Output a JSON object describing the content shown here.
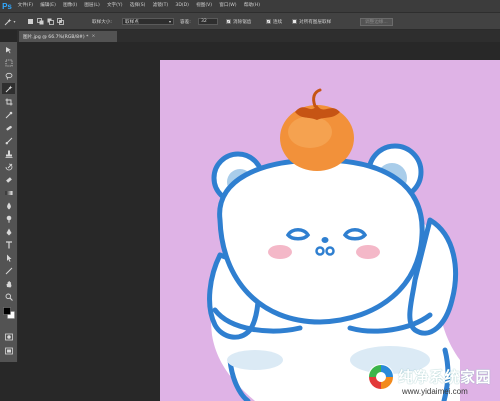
{
  "app": {
    "logo": "Ps"
  },
  "menu": [
    "文件(F)",
    "编辑(E)",
    "图像(I)",
    "图层(L)",
    "文字(Y)",
    "选择(S)",
    "滤镜(T)",
    "3D(D)",
    "视图(V)",
    "窗口(W)",
    "帮助(H)"
  ],
  "options": {
    "sample_size_label": "取样大小:",
    "sample_size_value": "取样点",
    "tolerance_label": "容差:",
    "tolerance_value": "32",
    "antialias_label": "消除锯齿",
    "antialias_checked": true,
    "contiguous_label": "连续",
    "contiguous_checked": true,
    "all_layers_label": "对所有图层取样",
    "all_layers_checked": false,
    "refine_edge_label": "调整边缘..."
  },
  "document": {
    "tab_title": "图片.jpg @ 66.7%(RGB/8#) *",
    "close": "×"
  },
  "tools": [
    "move-tool",
    "marquee-tool",
    "lasso-tool",
    "magic-wand-tool",
    "crop-tool",
    "eyedropper-tool",
    "healing-brush-tool",
    "brush-tool",
    "clone-stamp-tool",
    "history-brush-tool",
    "eraser-tool",
    "gradient-tool",
    "blur-tool",
    "dodge-tool",
    "pen-tool",
    "type-tool",
    "path-selection-tool",
    "line-tool",
    "hand-tool",
    "zoom-tool",
    "color-swatches",
    "quick-mask",
    "screen-mode"
  ],
  "canvas": {
    "background": "#dfb3e6",
    "image": "white bear cartoon with orange on head"
  },
  "watermark": {
    "title": "纯净系统家园",
    "url": "www.yidaimei.com"
  }
}
